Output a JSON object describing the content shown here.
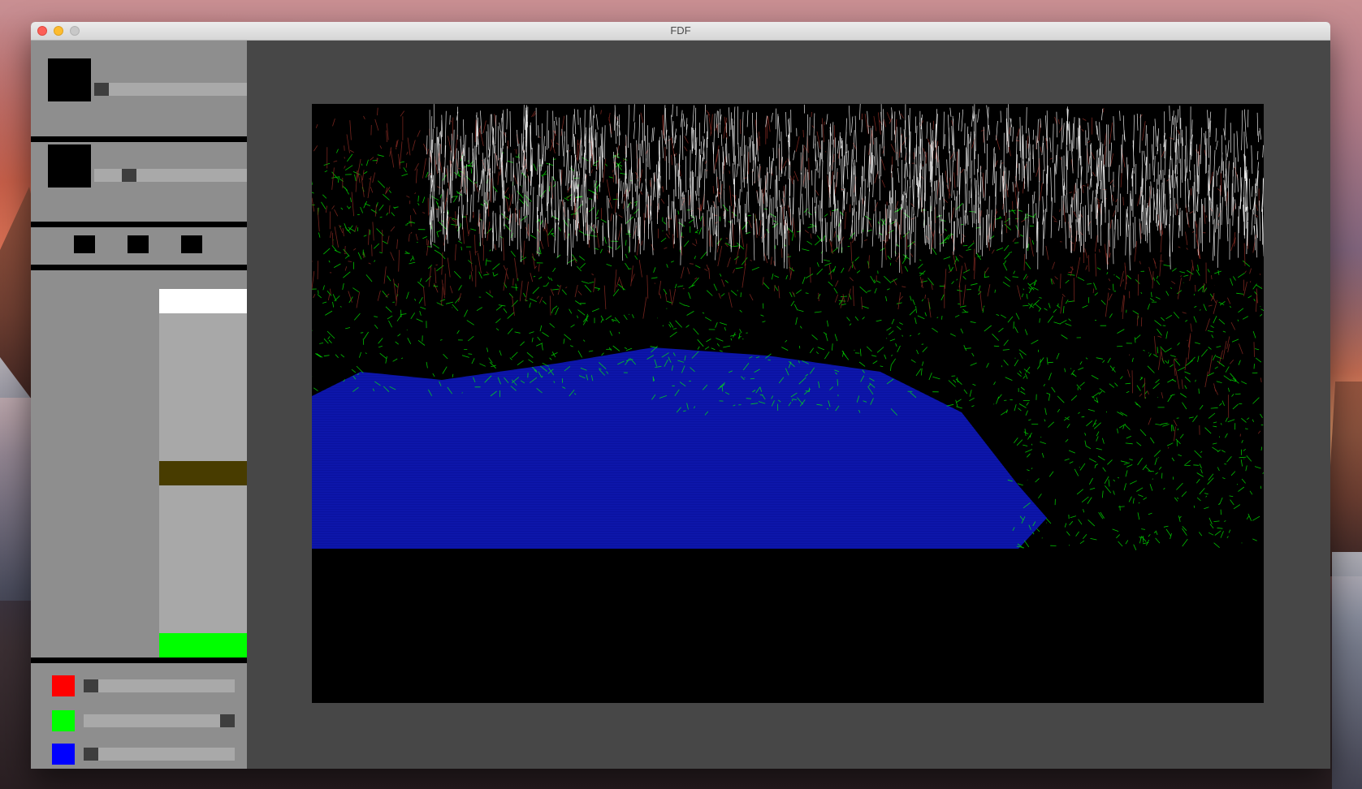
{
  "window": {
    "title": "FDF",
    "buttons": [
      "close",
      "minimize",
      "zoom"
    ]
  },
  "sidebar": {
    "slider_1": {
      "value": 0.0,
      "swatch_color": "#000000"
    },
    "slider_2": {
      "value": 0.2,
      "swatch_color": "#000000"
    },
    "toolbar_buttons": [
      "tool-1",
      "tool-2",
      "tool-3"
    ],
    "gradient_stops": [
      {
        "color": "#ffffff",
        "level": 1.0
      },
      {
        "color": "#483c00",
        "level": 0.5
      },
      {
        "color": "#00ff00",
        "level": 0.0
      }
    ],
    "rgb_sliders": [
      {
        "channel": "red",
        "color": "#ff0000",
        "value": 0.0
      },
      {
        "channel": "green",
        "color": "#00ff00",
        "value": 1.0
      },
      {
        "channel": "blue",
        "color": "#0000ff",
        "value": 0.0
      }
    ]
  },
  "viewport": {
    "background": "#000000",
    "render": "wireframe-terrain",
    "colors": {
      "water": "#0a14a8",
      "grass": "#00ff00",
      "rock": "#8a2a22",
      "snow": "#ffffff"
    }
  }
}
